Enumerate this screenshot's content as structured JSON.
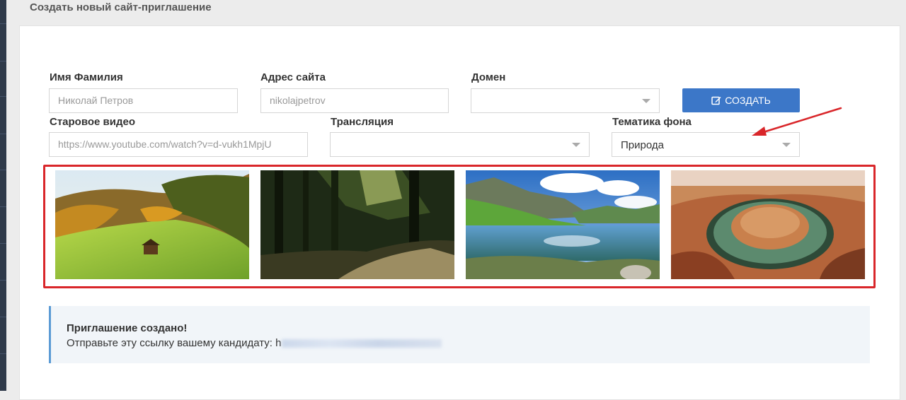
{
  "page": {
    "title": "Создать новый сайт-приглашение"
  },
  "form": {
    "name": {
      "label": "Имя Фамилия",
      "placeholder": "Николай Петров"
    },
    "address": {
      "label": "Адрес сайта",
      "placeholder": "nikolajpetrov"
    },
    "domain": {
      "label": "Домен",
      "value": ""
    },
    "video": {
      "label": "Старовое видео",
      "placeholder": "https://www.youtube.com/watch?v=d-vukh1MpjU"
    },
    "broadcast": {
      "label": "Трансляция",
      "value": ""
    },
    "theme": {
      "label": "Тематика фона",
      "value": "Природа"
    },
    "create_button": {
      "label": "СОЗДАТЬ",
      "icon": "edit-icon"
    }
  },
  "gallery": {
    "highlight_color": "#d9262a",
    "images": [
      "autumn-meadow",
      "forest-path",
      "mountain-lake",
      "canyon-bend"
    ]
  },
  "alert": {
    "title": "Приглашение создано!",
    "text": "Отправьте эту ссылку вашему кандидату: h",
    "accent_color": "#5b9bd5"
  },
  "colors": {
    "primary": "#3c77c8",
    "annotation": "#d9262a"
  }
}
